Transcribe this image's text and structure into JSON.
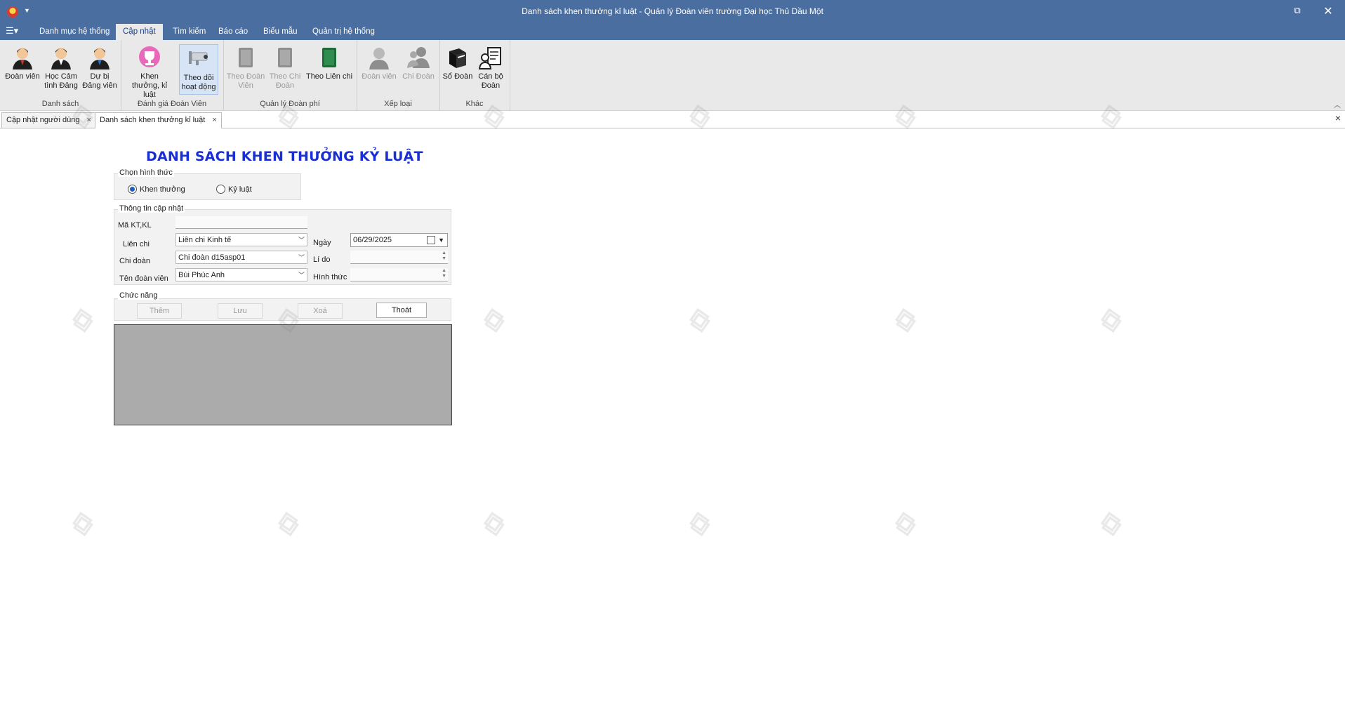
{
  "window": {
    "title": "Danh sách khen thưởng kỉ luật - Quản lý Đoàn viên trường Đại học Thủ Dầu Một"
  },
  "ribbon_tabs": [
    "Danh mục hệ thống",
    "Cập nhật",
    "Tìm kiếm",
    "Báo cáo",
    "Biểu mẫu",
    "Quản trị hệ thống"
  ],
  "ribbon_groups": {
    "danh_sach": {
      "label": "Danh sách",
      "buttons": [
        "Đoàn viên",
        "Học Cảm tình Đảng",
        "Dự bị Đảng viên"
      ]
    },
    "danh_gia": {
      "label": "Đánh giá Đoàn Viên",
      "buttons": [
        "Khen thưởng, kỉ luật",
        "Theo dõi hoạt động"
      ]
    },
    "doan_phi": {
      "label": "Quản lý Đoàn phí",
      "buttons": [
        "Theo Đoàn Viên",
        "Theo Chi Đoàn",
        "Theo Liên chi"
      ]
    },
    "xep_loai": {
      "label": "Xếp loại",
      "buttons": [
        "Đoàn viên",
        "Chi Đoàn"
      ]
    },
    "khac": {
      "label": "Khác",
      "buttons": [
        "Sổ Đoàn",
        "Cán bộ Đoàn"
      ]
    }
  },
  "doc_tabs": [
    "Cập nhật người dùng",
    "Danh sách khen thưởng kỉ luật"
  ],
  "form": {
    "title": "DANH SÁCH KHEN THƯỞNG KỶ LUẬT",
    "chon_hinh_thuc": {
      "legend": "Chọn hình thức",
      "options": [
        "Khen thưởng",
        "Kỷ luật"
      ],
      "selected": "Khen thưởng"
    },
    "thong_tin": {
      "legend": "Thông tin cập nhật",
      "ma_label": "Mã KT,KL",
      "ma_value": "",
      "lien_chi_label": "Liên chi",
      "lien_chi_value": "Liên chi Kinh tế",
      "chi_doan_label": "Chi đoàn",
      "chi_doan_value": "Chi đoàn d15asp01",
      "ten_doan_vien_label": "Tên đoàn viên",
      "ten_doan_vien_value": "Bùi Phúc Anh",
      "ngay_label": "Ngày",
      "ngay_value": "06/29/2025",
      "li_do_label": "Lí do",
      "li_do_value": "",
      "hinh_thuc_label": "Hình thức",
      "hinh_thuc_value": ""
    },
    "chuc_nang": {
      "legend": "Chức năng",
      "them": "Thêm",
      "luu": "Lưu",
      "xoa": "Xoá",
      "thoat": "Thoát"
    }
  },
  "icons": {
    "user": "person-icon",
    "trophy": "trophy-icon",
    "camera": "cctv-icon",
    "book": "book-icon",
    "group": "group-icon",
    "cadre": "cadre-icon"
  },
  "colors": {
    "titlebar": "#4a6ea0",
    "ribbon": "#e9e9e9",
    "form_title": "#1a2fd3",
    "grid": "#ababab"
  }
}
